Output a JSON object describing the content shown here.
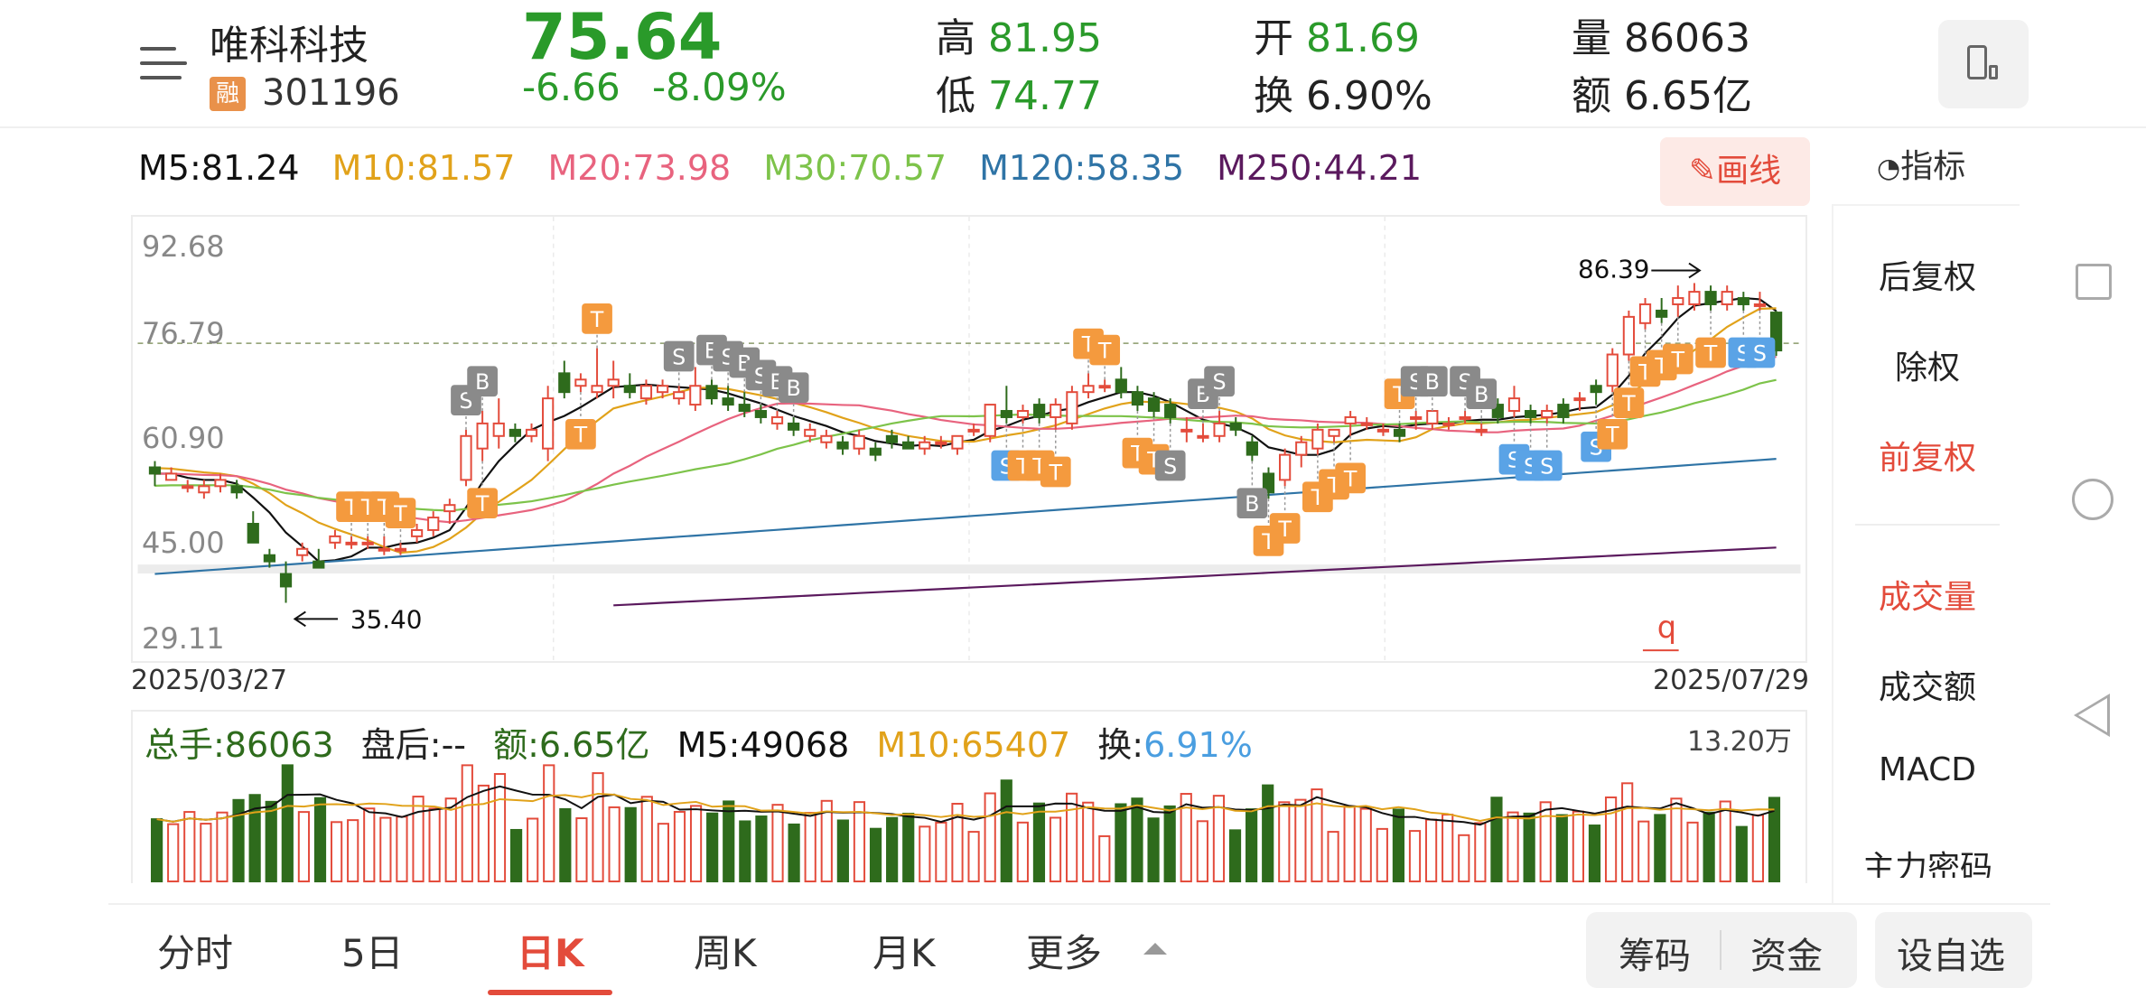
{
  "header": {
    "stock_name": "唯科科技",
    "rong_badge": "融",
    "stock_code": "301196",
    "price": "75.64",
    "change_abs": "-6.66",
    "change_pct": "-8.09%",
    "high_label": "高",
    "high_value": "81.95",
    "low_label": "低",
    "low_value": "74.77",
    "open_label": "开",
    "open_value": "81.69",
    "turnover_label": "换",
    "turnover_value": "6.90%",
    "volume_label": "量",
    "volume_value": "86063",
    "amount_label": "额",
    "amount_value": "6.65亿"
  },
  "ma": {
    "m5": "M5:81.24",
    "m10": "M10:81.57",
    "m20": "M20:73.98",
    "m30": "M30:70.57",
    "m120": "M120:58.35",
    "m250": "M250:44.21"
  },
  "colors": {
    "up": "#e34b3b",
    "down": "#2e6b1c",
    "m5": "#111111",
    "m10": "#e1a21a",
    "m20": "#e8637e",
    "m30": "#7dc34a",
    "m120": "#2f74a6",
    "m250": "#5b1a5e",
    "tag_T": "#f49a3e",
    "tag_B": "#8a8a8a",
    "tag_S_blue": "#5aa3e6"
  },
  "toolbar": {
    "draw_label": "画线",
    "indicator_label": "指标"
  },
  "chart": {
    "y_ticks": [
      "92.68",
      "76.79",
      "60.90",
      "45.00",
      "29.11"
    ],
    "start_date": "2025/03/27",
    "end_date": "2025/07/29",
    "high_marker": "86.39",
    "low_marker": "35.40",
    "q_marker": "q"
  },
  "volume": {
    "total": "总手:86063",
    "after_hours": "盘后:--",
    "amount": "额:6.65亿",
    "m5": "M5:49068",
    "m10": "M10:65407",
    "turnover_label": "换:",
    "turnover_value": "6.91%",
    "max_label": "13.20万"
  },
  "side_panel": {
    "items": [
      "后复权",
      "除权",
      "前复权",
      "成交量",
      "成交额",
      "MACD",
      "主力密码"
    ]
  },
  "tabs": {
    "items": [
      "分时",
      "5日",
      "日K",
      "周K",
      "月K",
      "更多"
    ]
  },
  "bottom_buttons": {
    "chips": "筹码",
    "funds": "资金",
    "add_watch": "设自选"
  },
  "chart_data": {
    "type": "candlestick",
    "y_range": [
      29.11,
      92.68
    ],
    "date_range": [
      "2025/03/27",
      "2025/07/29"
    ],
    "candles": [
      [
        57,
        58,
        54,
        56
      ],
      [
        55,
        57,
        55,
        56
      ],
      [
        54,
        55,
        53,
        54
      ],
      [
        53,
        55,
        52,
        54
      ],
      [
        54,
        56,
        53,
        55
      ],
      [
        54,
        55,
        52,
        53
      ],
      [
        48,
        50,
        45,
        45
      ],
      [
        43,
        44,
        41,
        42
      ],
      [
        40,
        42,
        35.4,
        38
      ],
      [
        43,
        45,
        42,
        44
      ],
      [
        42,
        44,
        41,
        41
      ],
      [
        45,
        47,
        44,
        46
      ],
      [
        45,
        46,
        44,
        45
      ],
      [
        45,
        46,
        44,
        45
      ],
      [
        44,
        46,
        43,
        44
      ],
      [
        44,
        45,
        43,
        44
      ],
      [
        46,
        48,
        45,
        47
      ],
      [
        47,
        50,
        46,
        49
      ],
      [
        50,
        52,
        48,
        51
      ],
      [
        55,
        63,
        54,
        62
      ],
      [
        60,
        66,
        58,
        64
      ],
      [
        62,
        68,
        60,
        64
      ],
      [
        63,
        64,
        61,
        62
      ],
      [
        62,
        64,
        61,
        63
      ],
      [
        60,
        70,
        58,
        68
      ],
      [
        72,
        74,
        68,
        69
      ],
      [
        70,
        72,
        69,
        71
      ],
      [
        69,
        76,
        68,
        70
      ],
      [
        70,
        74,
        68,
        71
      ],
      [
        70,
        72,
        68,
        69
      ],
      [
        68,
        71,
        67,
        70
      ],
      [
        69,
        71,
        68,
        70
      ],
      [
        68,
        70,
        67,
        69
      ],
      [
        67,
        73,
        66,
        70
      ],
      [
        70,
        71,
        67,
        68
      ],
      [
        68,
        70,
        66,
        67
      ],
      [
        67,
        69,
        65,
        66
      ],
      [
        66,
        67,
        64,
        65
      ],
      [
        64,
        66,
        63,
        65
      ],
      [
        64,
        65,
        62,
        63
      ],
      [
        62,
        64,
        61,
        63
      ],
      [
        61,
        63,
        60,
        62
      ],
      [
        61,
        62,
        59,
        60
      ],
      [
        60,
        63,
        59,
        62
      ],
      [
        60,
        61,
        58,
        59
      ],
      [
        62,
        63,
        60,
        61
      ],
      [
        61,
        62,
        60,
        60
      ],
      [
        60,
        62,
        59,
        61
      ],
      [
        61,
        62,
        60,
        61
      ],
      [
        60,
        62,
        59,
        62
      ],
      [
        63,
        64,
        62,
        63
      ],
      [
        62,
        67,
        61,
        67
      ],
      [
        66,
        70,
        64,
        65
      ],
      [
        65,
        67,
        64,
        66
      ],
      [
        67,
        68,
        64,
        65
      ],
      [
        65,
        68,
        63,
        67
      ],
      [
        64,
        70,
        63,
        69
      ],
      [
        69,
        72,
        68,
        70
      ],
      [
        70,
        71,
        69,
        70
      ],
      [
        71,
        73,
        68,
        69
      ],
      [
        69,
        70,
        66,
        67
      ],
      [
        68,
        69,
        65,
        66
      ],
      [
        67,
        68,
        64,
        65
      ],
      [
        63,
        65,
        61,
        63
      ],
      [
        62,
        64,
        61,
        62
      ],
      [
        62,
        66,
        61,
        64
      ],
      [
        64,
        65,
        62,
        63
      ],
      [
        61,
        62,
        58,
        59
      ],
      [
        56,
        57,
        52,
        53
      ],
      [
        55,
        60,
        54,
        59
      ],
      [
        59,
        62,
        57,
        61
      ],
      [
        60,
        64,
        59,
        63
      ],
      [
        62,
        63,
        61,
        63
      ],
      [
        64,
        66,
        62,
        65
      ],
      [
        64,
        65,
        63,
        64
      ],
      [
        63,
        64,
        62,
        63
      ],
      [
        63,
        64,
        61,
        62
      ],
      [
        65,
        66,
        63,
        65
      ],
      [
        64,
        66,
        63,
        66
      ],
      [
        64,
        65,
        63,
        64
      ],
      [
        65,
        66,
        64,
        65
      ],
      [
        63,
        64,
        62,
        63
      ],
      [
        67,
        68,
        64,
        65
      ],
      [
        66,
        70,
        65,
        68
      ],
      [
        66,
        67,
        64,
        65
      ],
      [
        65,
        67,
        64,
        66
      ],
      [
        67,
        68,
        64,
        65
      ],
      [
        68,
        69,
        66,
        68
      ],
      [
        70,
        71,
        67,
        69
      ],
      [
        70,
        76,
        69,
        75
      ],
      [
        75,
        82,
        74,
        81
      ],
      [
        80,
        84,
        79,
        83
      ],
      [
        82,
        84,
        80,
        81
      ],
      [
        83,
        86,
        81,
        84
      ],
      [
        83,
        86.39,
        82,
        85
      ],
      [
        85,
        86,
        82,
        83
      ],
      [
        83,
        86,
        82,
        85
      ],
      [
        84,
        85,
        82,
        83
      ],
      [
        83,
        85,
        82,
        83
      ],
      [
        81.69,
        81.95,
        74.77,
        75.64
      ]
    ],
    "volume_max": "13.20万"
  }
}
